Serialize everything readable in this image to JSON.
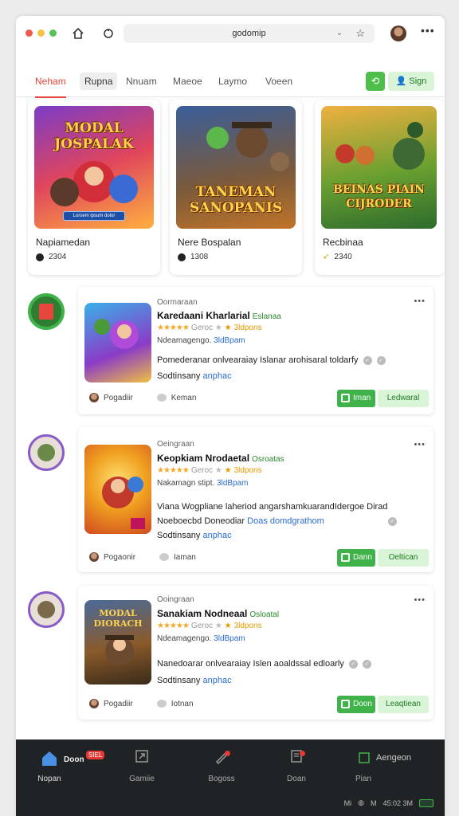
{
  "browser": {
    "address": "godomip",
    "colors": {
      "red": "#ee5a4f",
      "yellow": "#f5c342",
      "green": "#58c25a"
    }
  },
  "nav": {
    "tabs": [
      {
        "label": "Neham",
        "state": "active"
      },
      {
        "label": "Rupna",
        "state": "pill"
      },
      {
        "label": "Nnuam"
      },
      {
        "label": "Maeoe"
      },
      {
        "label": "Laymo"
      },
      {
        "label": "Voeen"
      }
    ],
    "sign_label": "Sign",
    "accent_color": "#e8463c"
  },
  "featured": [
    {
      "art_title": "MODAL JOSPALAK",
      "art_button": "Lorsem ipsum dolor",
      "name": "Napiamedan",
      "count": "2304"
    },
    {
      "art_title": "TANEMAN SANOPANIS",
      "name": "Nere Bospalan",
      "count": "1308"
    },
    {
      "art_title": "BEINAS PIAIN CIJRODER",
      "name": "Recbinaa",
      "count": "2340"
    }
  ],
  "apps": [
    {
      "category": "Oormaraan",
      "title": "Karedaani Kharlarial",
      "tag": "Eslanaa",
      "rating_sub": "Geroc",
      "score": "3ldpons",
      "meta_prefix": "Ndeamagengo",
      "meta_link": "3ldBpam",
      "desc": "Pomederanar onlvearaiay Islanar arohisaral toldarfy",
      "publisher_prefix": "Sodtinsany",
      "publisher_link": "anphac",
      "author": "Pogadiir",
      "comments": "Keman",
      "open_label": "Iman",
      "secondary_label": "Ledwaral"
    },
    {
      "category": "Oeingraan",
      "title": "Keopkiam Nrodaetal",
      "tag": "Osroatas",
      "rating_sub": "Geroc",
      "score": "3ldpons",
      "meta_prefix": "Nakamagn stipt",
      "meta_link": "3ldBpam",
      "desc": "Viana Wogpliane laheriod angarshamkuarandIdergoe Dirad",
      "desc2_prefix": "Noeboecbd Doneodiar",
      "desc2_link": "Doas domdgrathom",
      "publisher_prefix": "Sodtinsany",
      "publisher_link": "anphac",
      "author": "Pogaonir",
      "comments": "Iaman",
      "open_label": "Dann",
      "secondary_label": "Oeltican"
    },
    {
      "category": "Ooingraan",
      "title": "Sanakiam Nodneaal",
      "tag": "Osloatal",
      "rating_sub": "Geroc",
      "score": "3ldpons",
      "meta_prefix": "Ndeamagengo",
      "meta_link": "3ldBpam",
      "desc": "Nanedoarar onlvearaiay Islen aoaldssal edloarly",
      "publisher_prefix": "Sodtinsany",
      "publisher_link": "anphac",
      "author": "Pogadiir",
      "comments": "Iotnan",
      "open_label": "Doon",
      "secondary_label": "Leaqtiean"
    }
  ],
  "bottom_nav": {
    "items": [
      {
        "label": "Nopan",
        "top_label": "Doon",
        "badge": "SIEL"
      },
      {
        "label": "Gamiie"
      },
      {
        "label": "Bogoss"
      },
      {
        "label": "Doan"
      },
      {
        "label": "Pian",
        "top_label": "Aengeon"
      }
    ],
    "status": {
      "mark_a": "Mi",
      "mark_b": "M",
      "time": "45:02 3M"
    }
  }
}
